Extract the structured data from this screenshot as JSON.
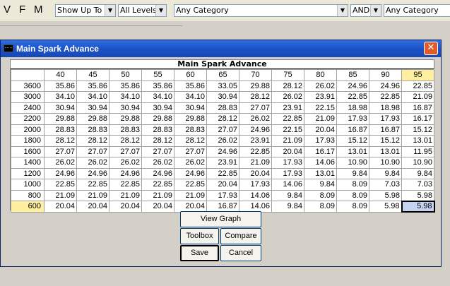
{
  "toolbar": {
    "letters": [
      "V",
      "F",
      "M"
    ],
    "show_up_to": "Show Up To",
    "levels": "All Levels",
    "category1": "Any Category",
    "logic": "AND",
    "category2": "Any Category"
  },
  "window": {
    "title": "Main Spark Advance",
    "close": "✕"
  },
  "table": {
    "title": "Main Spark Advance",
    "columns": [
      "40",
      "45",
      "50",
      "55",
      "60",
      "65",
      "70",
      "75",
      "80",
      "85",
      "90",
      "95"
    ],
    "rows": [
      {
        "label": "3600",
        "values": [
          "35.86",
          "35.86",
          "35.86",
          "35.86",
          "35.86",
          "33.05",
          "29.88",
          "28.12",
          "26.02",
          "24.96",
          "24.96",
          "22.85"
        ]
      },
      {
        "label": "3000",
        "values": [
          "34.10",
          "34.10",
          "34.10",
          "34.10",
          "34.10",
          "30.94",
          "28.12",
          "26.02",
          "23.91",
          "22.85",
          "22.85",
          "21.09"
        ]
      },
      {
        "label": "2400",
        "values": [
          "30.94",
          "30.94",
          "30.94",
          "30.94",
          "30.94",
          "28.83",
          "27.07",
          "23.91",
          "22.15",
          "18.98",
          "18.98",
          "16.87"
        ]
      },
      {
        "label": "2200",
        "values": [
          "29.88",
          "29.88",
          "29.88",
          "29.88",
          "29.88",
          "28.12",
          "26.02",
          "22.85",
          "21.09",
          "17.93",
          "17.93",
          "16.17"
        ]
      },
      {
        "label": "2000",
        "values": [
          "28.83",
          "28.83",
          "28.83",
          "28.83",
          "28.83",
          "27.07",
          "24.96",
          "22.15",
          "20.04",
          "16.87",
          "16.87",
          "15.12"
        ]
      },
      {
        "label": "1800",
        "values": [
          "28.12",
          "28.12",
          "28.12",
          "28.12",
          "28.12",
          "26.02",
          "23.91",
          "21.09",
          "17.93",
          "15.12",
          "15.12",
          "13.01"
        ]
      },
      {
        "label": "1600",
        "values": [
          "27.07",
          "27.07",
          "27.07",
          "27.07",
          "27.07",
          "24.96",
          "22.85",
          "20.04",
          "16.17",
          "13.01",
          "13.01",
          "11.95"
        ]
      },
      {
        "label": "1400",
        "values": [
          "26.02",
          "26.02",
          "26.02",
          "26.02",
          "26.02",
          "23.91",
          "21.09",
          "17.93",
          "14.06",
          "10.90",
          "10.90",
          "10.90"
        ]
      },
      {
        "label": "1200",
        "values": [
          "24.96",
          "24.96",
          "24.96",
          "24.96",
          "24.96",
          "22.85",
          "20.04",
          "17.93",
          "13.01",
          "9.84",
          "9.84",
          "9.84"
        ]
      },
      {
        "label": "1000",
        "values": [
          "22.85",
          "22.85",
          "22.85",
          "22.85",
          "22.85",
          "20.04",
          "17.93",
          "14.06",
          "9.84",
          "8.09",
          "7.03",
          "7.03"
        ]
      },
      {
        "label": "800",
        "values": [
          "21.09",
          "21.09",
          "21.09",
          "21.09",
          "21.09",
          "17.93",
          "14.06",
          "9.84",
          "8.09",
          "8.09",
          "5.98",
          "5.98"
        ]
      },
      {
        "label": "600",
        "values": [
          "20.04",
          "20.04",
          "20.04",
          "20.04",
          "20.04",
          "16.87",
          "14.06",
          "9.84",
          "8.09",
          "8.09",
          "5.98",
          "5.98"
        ]
      }
    ],
    "highlight_column": "95",
    "highlight_row": "600",
    "selected_cell": {
      "row": "600",
      "column": "95"
    },
    "highlight_color": "#ffef9f",
    "selected_color": "#c6d3f2"
  },
  "buttons": {
    "view_graph": "View Graph",
    "toolbox": "Toolbox",
    "compare": "Compare",
    "save": "Save",
    "cancel": "Cancel"
  }
}
